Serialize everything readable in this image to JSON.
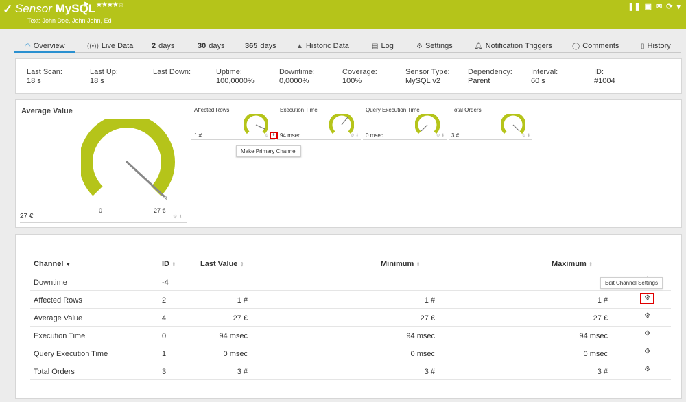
{
  "header": {
    "title_prefix": "Sensor",
    "title_name": "MySQL",
    "flag_icon": "flag-icon",
    "stars": "★★★★☆",
    "subtitle": "Text: John Doe, John John, Ed",
    "icons": [
      "pause-icon",
      "report-icon",
      "email-icon",
      "refresh-icon",
      "dropdown-icon"
    ]
  },
  "tabs": [
    {
      "label": "Overview",
      "icon": "overview-icon",
      "active": true
    },
    {
      "label": "Live Data",
      "icon": "live-data-icon"
    },
    {
      "num": "2",
      "label": "days"
    },
    {
      "num": "30",
      "label": "days"
    },
    {
      "num": "365",
      "label": "days"
    },
    {
      "label": "Historic Data",
      "icon": "chart-icon"
    },
    {
      "label": "Log",
      "icon": "log-icon"
    },
    {
      "label": "Settings",
      "icon": "gear-icon"
    },
    {
      "label": "Notification Triggers",
      "icon": "bell-icon"
    },
    {
      "label": "Comments",
      "icon": "comment-icon"
    },
    {
      "label": "History",
      "icon": "history-icon"
    }
  ],
  "info": [
    {
      "label": "Last Scan:",
      "value": "18 s"
    },
    {
      "label": "Last Up:",
      "value": "18 s"
    },
    {
      "label": "Last Down:",
      "value": ""
    },
    {
      "label": "Uptime:",
      "value": "100,0000%"
    },
    {
      "label": "Downtime:",
      "value": "0,0000%"
    },
    {
      "label": "Coverage:",
      "value": "100%"
    },
    {
      "label": "Sensor Type:",
      "value": "MySQL v2"
    },
    {
      "label": "Dependency:",
      "value": "Parent"
    },
    {
      "label": "Interval:",
      "value": "60 s"
    },
    {
      "label": "ID:",
      "value": "#1004"
    }
  ],
  "primary_gauge": {
    "title": "Average Value",
    "min": "0",
    "max": "27 €",
    "value": "27 €",
    "fill_fraction": 1.0,
    "xbar": "x̄"
  },
  "small_gauges": [
    {
      "title": "Affected Rows",
      "value": "1 #",
      "fill_fraction": 1.0
    },
    {
      "title": "Execution Time",
      "value": "94 msec",
      "fill_fraction": 1.0
    },
    {
      "title": "Query Execution Time",
      "value": "0 msec",
      "fill_fraction": 1.0
    },
    {
      "title": "Total Orders",
      "value": "3 #",
      "fill_fraction": 1.0
    }
  ],
  "tooltips": {
    "make_primary": "Make Primary Channel",
    "edit_channel": "Edit Channel Settings"
  },
  "table": {
    "headers": {
      "channel": "Channel",
      "id": "ID",
      "last": "Last Value",
      "min": "Minimum",
      "max": "Maximum"
    },
    "rows": [
      {
        "name": "Downtime",
        "id": "-4",
        "last": "",
        "min": "",
        "max": ""
      },
      {
        "name": "Affected Rows",
        "id": "2",
        "last": "1 #",
        "min": "1 #",
        "max": "1 #"
      },
      {
        "name": "Average Value",
        "id": "4",
        "last": "27 €",
        "min": "27 €",
        "max": "27 €"
      },
      {
        "name": "Execution Time",
        "id": "0",
        "last": "94 msec",
        "min": "94 msec",
        "max": "94 msec"
      },
      {
        "name": "Query Execution Time",
        "id": "1",
        "last": "0 msec",
        "min": "0 msec",
        "max": "0 msec"
      },
      {
        "name": "Total Orders",
        "id": "3",
        "last": "3 #",
        "min": "3 #",
        "max": "3 #"
      }
    ]
  },
  "colors": {
    "header": "#b5c41a",
    "gauge": "#b5c41a",
    "accent": "#2a90d0",
    "highlight": "#e00000"
  }
}
